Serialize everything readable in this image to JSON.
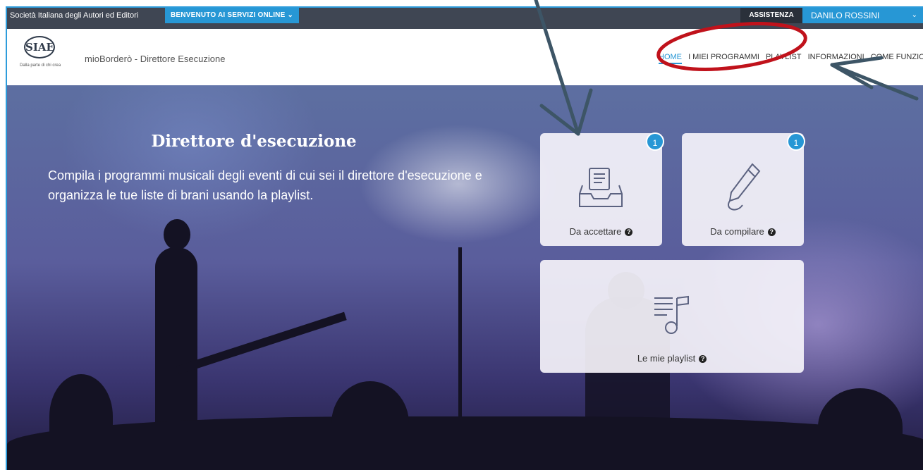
{
  "topbar": {
    "org": "Società Italiana degli Autori ed Editori",
    "welcome": "BENVENUTO AI SERVIZI ONLINE",
    "assistance": "ASSISTENZA",
    "user": "DANILO ROSSINI"
  },
  "header": {
    "logo_text": "SIAE",
    "logo_tagline": "Dalla parte di chi crea",
    "app_title": "mioBorderò - Direttore Esecuzione",
    "nav": [
      "HOME",
      "I MIEI PROGRAMMI",
      "PLAYLIST",
      "INFORMAZIONI",
      "COME FUNZIONA"
    ]
  },
  "hero": {
    "title": "Direttore d'esecuzione",
    "subtitle": "Compila i programmi musicali degli eventi di cui sei il direttore d'esecuzione e organizza le tue liste di brani usando la playlist."
  },
  "cards": {
    "accept": {
      "label": "Da accettare",
      "badge": "1",
      "icon": "inbox-document-icon"
    },
    "compile": {
      "label": "Da compilare",
      "badge": "1",
      "icon": "pencil-icon"
    },
    "playlist": {
      "label": "Le mie playlist",
      "icon": "music-playlist-icon"
    }
  },
  "colors": {
    "accent": "#2797d5",
    "topbar": "#3f4653",
    "annotation": "#c0121b",
    "arrow": "#3d5566"
  }
}
